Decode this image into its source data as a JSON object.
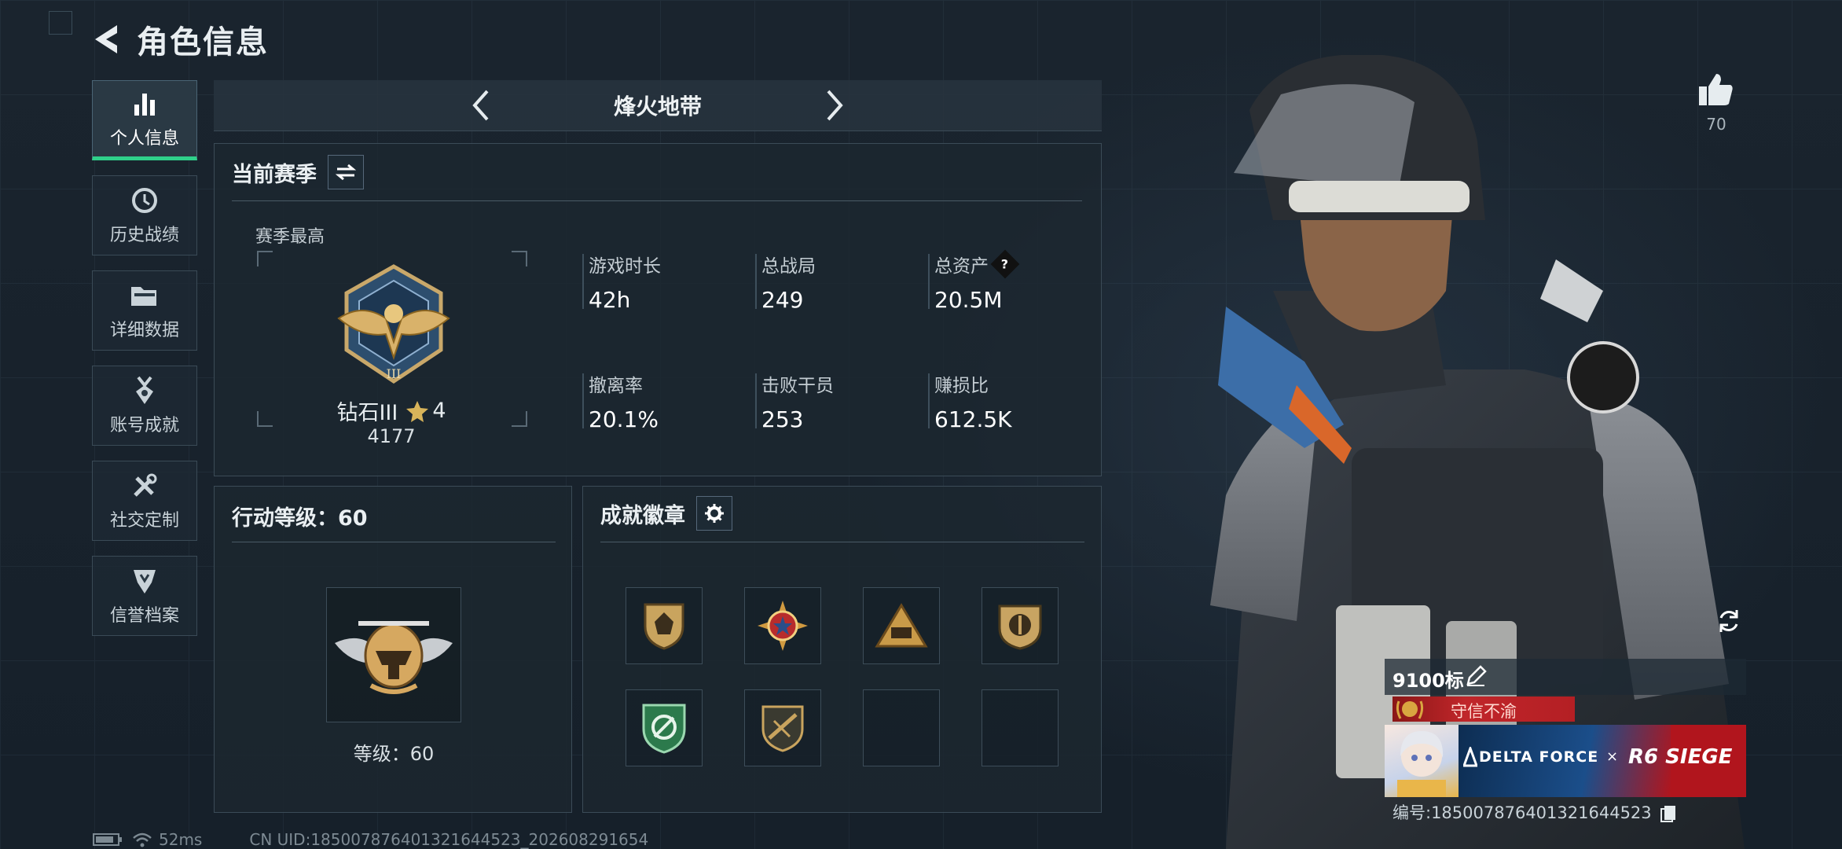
{
  "header": {
    "title": "角色信息"
  },
  "sidebar": {
    "items": [
      {
        "label": "个人信息",
        "icon": "bar-chart-icon",
        "active": true
      },
      {
        "label": "历史战绩",
        "icon": "clock-icon",
        "active": false
      },
      {
        "label": "详细数据",
        "icon": "folder-icon",
        "active": false
      },
      {
        "label": "账号成就",
        "icon": "medal-icon",
        "active": false
      },
      {
        "label": "社交定制",
        "icon": "tools-icon",
        "active": false
      },
      {
        "label": "信誉档案",
        "icon": "shield-badge-icon",
        "active": false
      }
    ]
  },
  "mode": {
    "name": "烽火地带"
  },
  "season": {
    "title": "当前赛季",
    "best_label": "赛季最高",
    "rank_name": "钻石III",
    "rank_stars": "4",
    "rank_score": "4177",
    "stats": [
      {
        "label": "游戏时长",
        "value": "42h"
      },
      {
        "label": "总战局",
        "value": "249"
      },
      {
        "label": "总资产",
        "value": "20.5M",
        "help": "?"
      },
      {
        "label": "撤离率",
        "value": "20.1%"
      },
      {
        "label": "击败干员",
        "value": "253"
      },
      {
        "label": "赚损比",
        "value": "612.5K"
      }
    ]
  },
  "action_level": {
    "title": "行动等级：60",
    "level_text": "等级：60"
  },
  "achievements": {
    "title": "成就徽章",
    "badges": [
      "shield-badge-icon",
      "star-cross-badge-icon",
      "triangle-badge-icon",
      "round-shield-badge-icon",
      "green-shield-badge-icon",
      "rifle-badge-icon",
      "",
      ""
    ]
  },
  "likes": {
    "count": "70"
  },
  "player_card": {
    "name": "9100标",
    "title_tag": "守信不渝",
    "brand_left": "DELTA FORCE",
    "brand_x": "×",
    "brand_right": "R6 SIEGE",
    "id_text": "编号:18500787640132164452​3"
  },
  "footer": {
    "ping": "52ms",
    "uid": "CN UID:18500787640132164452​3_202608291654"
  },
  "colors": {
    "accent": "#2fd08a",
    "panel": "#1c2730",
    "tag_red": "#c0262a"
  }
}
